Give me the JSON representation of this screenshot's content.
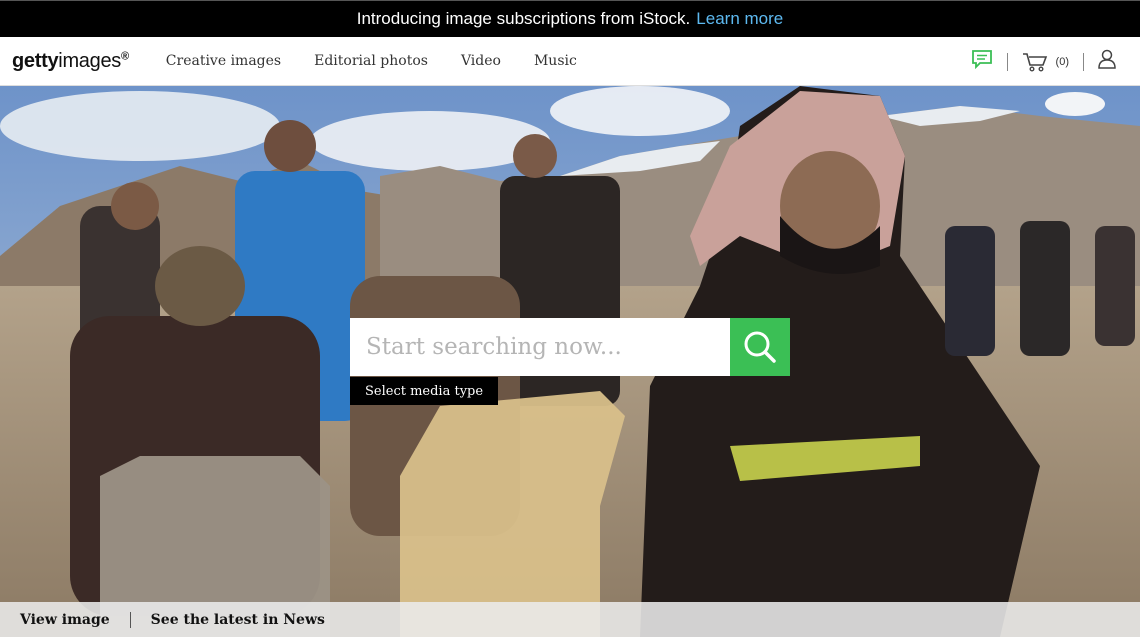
{
  "promo": {
    "text": "Introducing image subscriptions from iStock.",
    "link": "Learn more"
  },
  "header": {
    "logo_bold": "getty",
    "logo_rest": "images",
    "logo_mark": "®",
    "nav": [
      "Creative images",
      "Editorial photos",
      "Video",
      "Music"
    ],
    "cart_count": "(0)",
    "icons": [
      "chat-icon",
      "cart-icon",
      "user-icon"
    ]
  },
  "search": {
    "placeholder": "Start searching now...",
    "media_type": "Select media type"
  },
  "footer": {
    "view_image": "View image",
    "latest_news": "See the latest in News"
  },
  "colors": {
    "promo_bg": "#000000",
    "link": "#5db9f0",
    "search_button": "#3bbf55",
    "chat_icon": "#3bbf55"
  }
}
